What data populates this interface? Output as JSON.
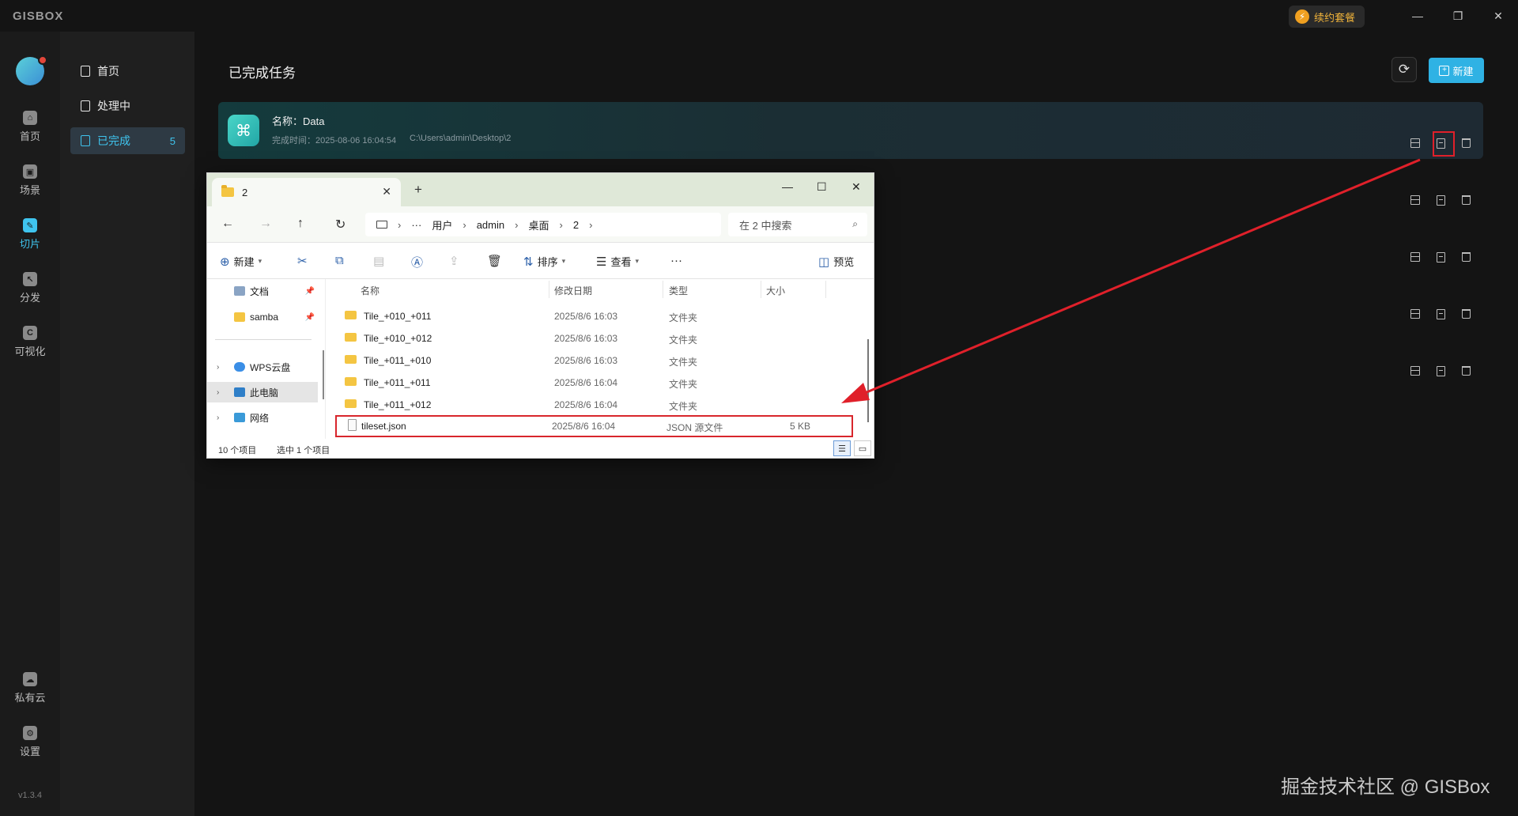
{
  "app": {
    "logo": "GISBOX",
    "renew_label": "续约套餐",
    "version": "v1.3.4"
  },
  "rail": [
    {
      "label": "首页",
      "glyph": "⌂"
    },
    {
      "label": "场景",
      "glyph": "▣"
    },
    {
      "label": "切片",
      "glyph": "✎"
    },
    {
      "label": "分发",
      "glyph": "↖"
    },
    {
      "label": "可视化",
      "glyph": "C"
    },
    {
      "label": "私有云",
      "glyph": "☁"
    },
    {
      "label": "设置",
      "glyph": "⚙"
    }
  ],
  "submenu": [
    {
      "label": "首页"
    },
    {
      "label": "处理中"
    },
    {
      "label": "已完成",
      "count": "5"
    }
  ],
  "main": {
    "title": "已完成任务",
    "new_label": "新建",
    "task": {
      "name": "名称：Data",
      "finished": "完成时间：2025-08-06 16:04:54",
      "path": "C:\\Users\\admin\\Desktop\\2"
    }
  },
  "explorer": {
    "tab_title": "2",
    "address": [
      "用户",
      "admin",
      "桌面",
      "2"
    ],
    "search_placeholder": "在 2 中搜索",
    "toolbar": {
      "new": "新建",
      "sort": "排序",
      "view": "查看",
      "preview": "预览"
    },
    "sidebar": [
      {
        "label": "文档"
      },
      {
        "label": "samba"
      },
      {
        "label": "WPS云盘"
      },
      {
        "label": "此电脑"
      },
      {
        "label": "网络"
      }
    ],
    "columns": [
      "名称",
      "修改日期",
      "类型",
      "大小"
    ],
    "rows": [
      {
        "name": "Tile_+010_+011",
        "date": "2025/8/6 16:03",
        "type": "文件夹",
        "size": ""
      },
      {
        "name": "Tile_+010_+012",
        "date": "2025/8/6 16:03",
        "type": "文件夹",
        "size": ""
      },
      {
        "name": "Tile_+011_+010",
        "date": "2025/8/6 16:03",
        "type": "文件夹",
        "size": ""
      },
      {
        "name": "Tile_+011_+011",
        "date": "2025/8/6 16:04",
        "type": "文件夹",
        "size": ""
      },
      {
        "name": "Tile_+011_+012",
        "date": "2025/8/6 16:04",
        "type": "文件夹",
        "size": ""
      },
      {
        "name": "tileset.json",
        "date": "2025/8/6 16:04",
        "type": "JSON 源文件",
        "size": "5 KB"
      }
    ],
    "status": {
      "count": "10 个项目",
      "selected": "选中 1 个项目"
    }
  },
  "watermark": "掘金技术社区 @ GISBox"
}
